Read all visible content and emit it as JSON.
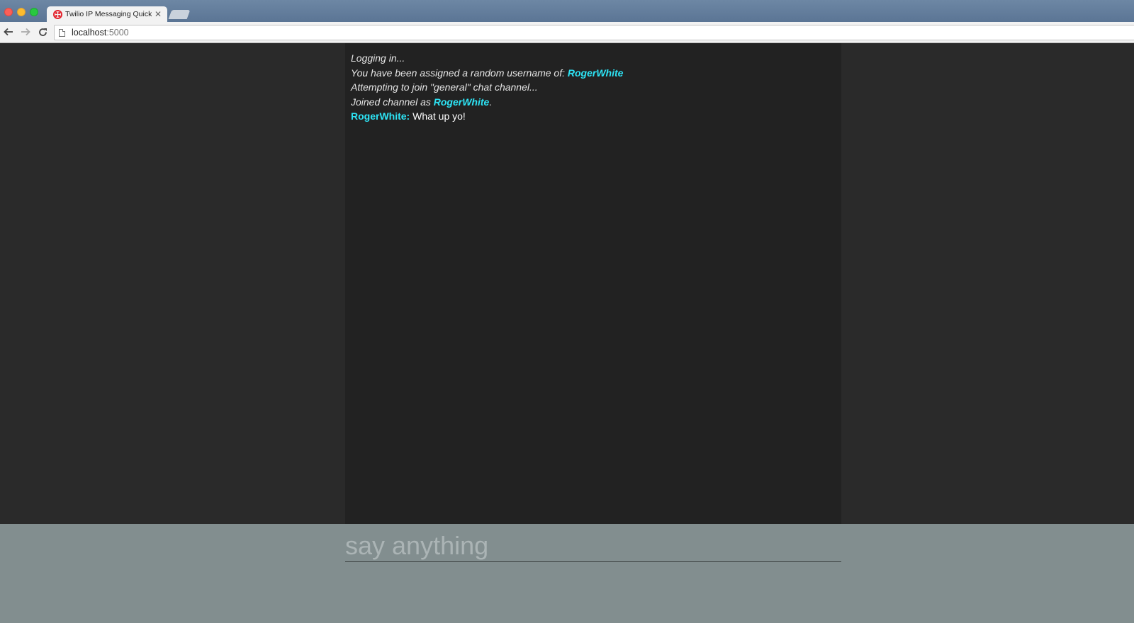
{
  "browser": {
    "tab": {
      "title": "Twilio IP Messaging Quickstart",
      "close_icon": "close-icon",
      "favicon": "twilio-logo-icon"
    },
    "url": {
      "host": "localhost",
      "port": ":5000"
    },
    "icons": {
      "back": "back-arrow-icon",
      "forward": "forward-arrow-icon",
      "reload": "reload-icon",
      "page": "page-icon"
    }
  },
  "chat": {
    "messages": [
      {
        "type": "info",
        "text": "Logging in..."
      },
      {
        "type": "info",
        "text": "You have been assigned a random username of: ",
        "username": "RogerWhite"
      },
      {
        "type": "info",
        "text": "Attempting to join \"general\" chat channel..."
      },
      {
        "type": "info",
        "text": "Joined channel as ",
        "username": "RogerWhite",
        "suffix": "."
      },
      {
        "type": "chat",
        "username": "RogerWhite:",
        "text": " What up yo!"
      }
    ]
  },
  "composer": {
    "placeholder": "say anything",
    "value": ""
  },
  "colors": {
    "page_background": "#2a2a2a",
    "messages_background": "#222222",
    "composer_background": "#828e8f",
    "username": "#2de4f5",
    "message_text": "#e6e6e6"
  }
}
